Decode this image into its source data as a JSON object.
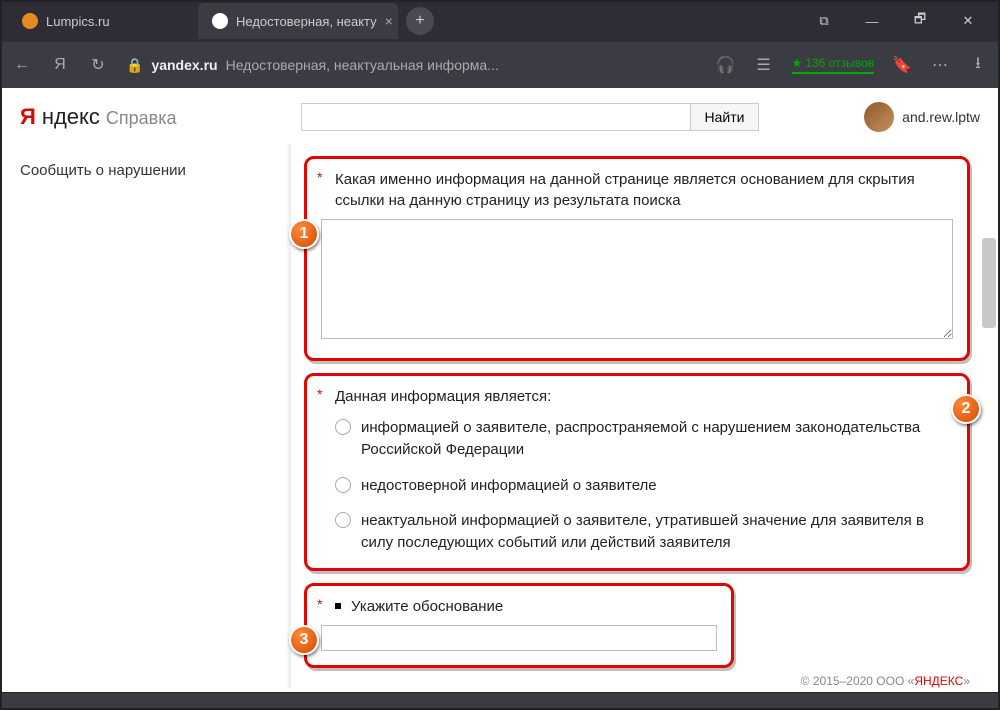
{
  "browser": {
    "tabs": [
      {
        "title": "Lumpics.ru",
        "favicon_color": "#e58a1f"
      },
      {
        "title": "Недостоверная, неакту",
        "favicon_color": "#fff"
      }
    ],
    "active_tab": 1,
    "url_domain": "yandex.ru",
    "url_path": "Недостоверная, неактуальная информа...",
    "reviews": "136 отзывов",
    "win": {
      "min": "—",
      "max": "🗗",
      "close": "✕"
    }
  },
  "logo": {
    "brand_y": "Я",
    "brand_rest": "ндекс",
    "section": "Справка"
  },
  "search": {
    "button": "Найти",
    "placeholder": ""
  },
  "user": {
    "name": "and.rew.lptw"
  },
  "sidebar": {
    "item": "Сообщить о нарушении"
  },
  "form": {
    "q1_label": "Какая именно информация на данной странице является основанием для скрытия ссылки на данную страницу из результата поиска",
    "q2_label": "Данная информация является:",
    "q2_options": [
      "информацией о заявителе, распространяемой с нарушением законодательства Российской Федерации",
      "недостоверной информацией о заявителе",
      "неактуальной информацией о заявителе, утратившей значение для заявителя в силу последующих событий или действий заявителя"
    ],
    "q3_label": "Укажите обоснование"
  },
  "footer": {
    "copyright": "© 2015–2020  ООО «",
    "link": "ЯНДЕКС",
    "tail": "»"
  },
  "markers": {
    "m1": "1",
    "m2": "2",
    "m3": "3"
  }
}
